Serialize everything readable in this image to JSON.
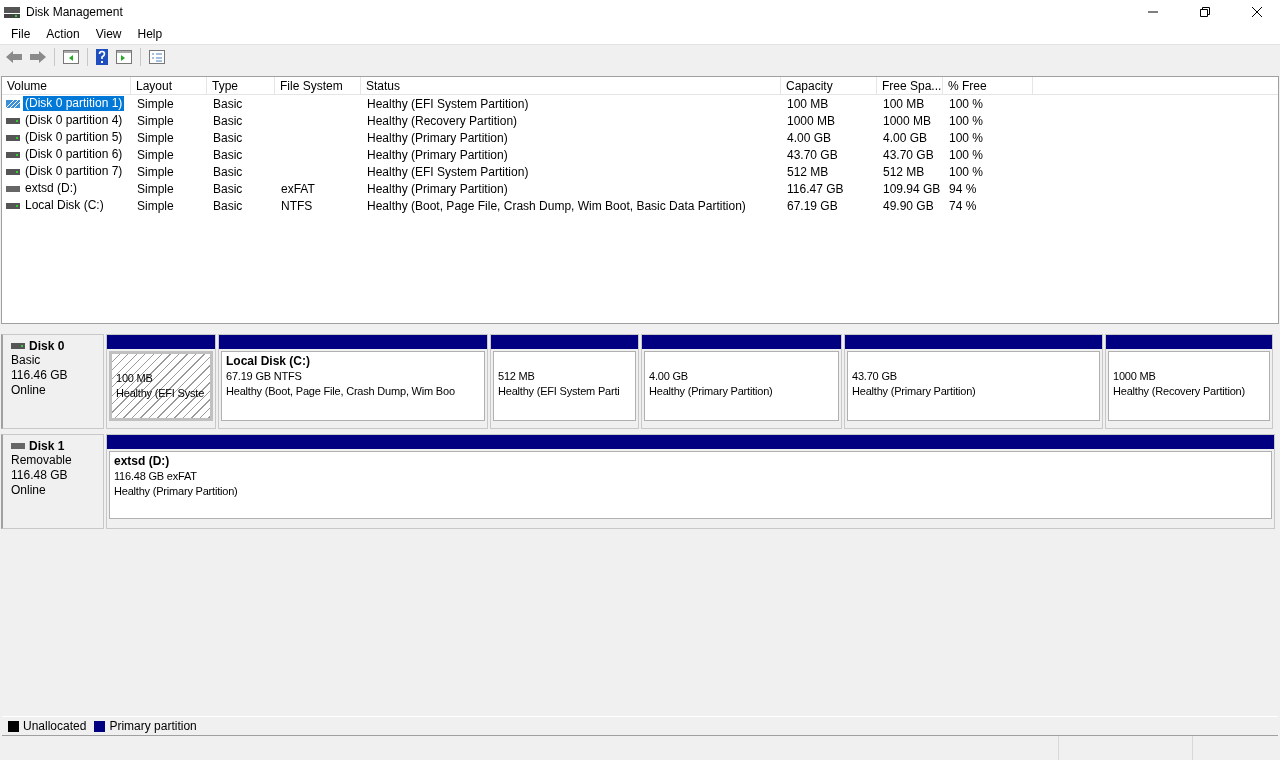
{
  "window": {
    "title": "Disk Management"
  },
  "menu": [
    "File",
    "Action",
    "View",
    "Help"
  ],
  "table": {
    "columns": [
      "Volume",
      "Layout",
      "Type",
      "File System",
      "Status",
      "Capacity",
      "Free Spa...",
      "% Free"
    ],
    "rows": [
      {
        "selected": true,
        "kind": "hatched",
        "cells": [
          "(Disk 0 partition 1)",
          "Simple",
          "Basic",
          "",
          "Healthy (EFI System Partition)",
          "100 MB",
          "100 MB",
          "100 %"
        ]
      },
      {
        "selected": false,
        "kind": "drive",
        "cells": [
          "(Disk 0 partition 4)",
          "Simple",
          "Basic",
          "",
          "Healthy (Recovery Partition)",
          "1000 MB",
          "1000 MB",
          "100 %"
        ]
      },
      {
        "selected": false,
        "kind": "drive",
        "cells": [
          "(Disk 0 partition 5)",
          "Simple",
          "Basic",
          "",
          "Healthy (Primary Partition)",
          "4.00 GB",
          "4.00 GB",
          "100 %"
        ]
      },
      {
        "selected": false,
        "kind": "drive",
        "cells": [
          "(Disk 0 partition 6)",
          "Simple",
          "Basic",
          "",
          "Healthy (Primary Partition)",
          "43.70 GB",
          "43.70 GB",
          "100 %"
        ]
      },
      {
        "selected": false,
        "kind": "drive",
        "cells": [
          "(Disk 0 partition 7)",
          "Simple",
          "Basic",
          "",
          "Healthy (EFI System Partition)",
          "512 MB",
          "512 MB",
          "100 %"
        ]
      },
      {
        "selected": false,
        "kind": "removable",
        "cells": [
          "extsd (D:)",
          "Simple",
          "Basic",
          "exFAT",
          "Healthy (Primary Partition)",
          "116.47 GB",
          "109.94 GB",
          "94 %"
        ]
      },
      {
        "selected": false,
        "kind": "drive",
        "cells": [
          "Local Disk (C:)",
          "Simple",
          "Basic",
          "NTFS",
          "Healthy (Boot, Page File, Crash Dump, Wim Boot, Basic Data Partition)",
          "67.19 GB",
          "49.90 GB",
          "74 %"
        ]
      }
    ]
  },
  "disks": [
    {
      "name": "Disk 0",
      "kind": "drive",
      "type": "Basic",
      "size": "116.46 GB",
      "status": "Online",
      "partitions": [
        {
          "selected": true,
          "size": "100 MB",
          "status": "Healthy (EFI Syste"
        },
        {
          "selected": false,
          "name": "Local Disk  (C:)",
          "size": "67.19 GB NTFS",
          "status": "Healthy (Boot, Page File, Crash Dump, Wim Boo"
        },
        {
          "selected": false,
          "size": "512 MB",
          "status": "Healthy (EFI System Parti"
        },
        {
          "selected": false,
          "size": "4.00 GB",
          "status": "Healthy (Primary Partition)"
        },
        {
          "selected": false,
          "size": "43.70 GB",
          "status": "Healthy (Primary Partition)"
        },
        {
          "selected": false,
          "size": "1000 MB",
          "status": "Healthy (Recovery Partition)"
        }
      ]
    },
    {
      "name": "Disk 1",
      "kind": "removable",
      "type": "Removable",
      "size": "116.48 GB",
      "status": "Online",
      "partitions": [
        {
          "selected": false,
          "name": "extsd  (D:)",
          "size": "116.48 GB exFAT",
          "status": "Healthy (Primary Partition)"
        }
      ]
    }
  ],
  "legend": [
    {
      "label": "Unallocated",
      "color": "#000000"
    },
    {
      "label": "Primary partition",
      "color": "#000080"
    }
  ]
}
